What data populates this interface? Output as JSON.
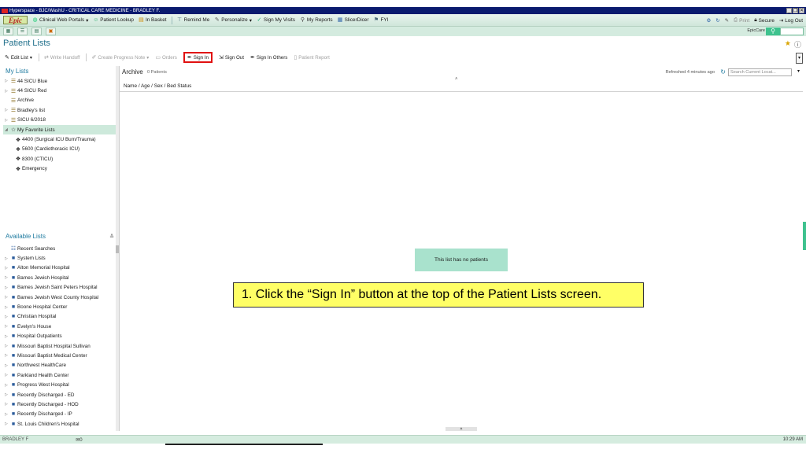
{
  "window": {
    "title": "Hyperspace - BJC/WashU - CRITICAL CARE MEDICINE - BRADLEY F."
  },
  "menu": {
    "logo": "Epic",
    "items": [
      {
        "label": "Clinical Web Portals",
        "icon": "globe-icon"
      },
      {
        "label": "Patient Lookup",
        "icon": "person-icon"
      },
      {
        "label": "In Basket",
        "icon": "inbox-icon"
      },
      {
        "label": "Remind Me",
        "icon": "pin-icon"
      },
      {
        "label": "Personalize",
        "icon": "wrench-icon"
      },
      {
        "label": "Sign My Visits",
        "icon": "check-icon"
      },
      {
        "label": "My Reports",
        "icon": "magnifier-icon"
      },
      {
        "label": "SlicerDicer",
        "icon": "chart-icon"
      },
      {
        "label": "FYI",
        "icon": "flag-icon"
      }
    ],
    "right": {
      "print": "Print",
      "secure": "Secure",
      "logout": "Log Out"
    }
  },
  "row2": {
    "epiccare": "EpicCare"
  },
  "page": {
    "title": "Patient Lists"
  },
  "toolbar": {
    "edit_list": "Edit List",
    "write_handoff": "Write Handoff",
    "create_progress_note": "Create Progress Note",
    "orders": "Orders",
    "sign_in": "Sign In",
    "sign_out": "Sign Out",
    "sign_in_others": "Sign In Others",
    "patient_report": "Patient Report"
  },
  "my_lists": {
    "heading": "My Lists",
    "items": [
      {
        "label": "44 SICU Blue"
      },
      {
        "label": "44 SICU Red"
      },
      {
        "label": "Archive"
      },
      {
        "label": "Bradley's list"
      },
      {
        "label": "SICU 6/2018"
      },
      {
        "label": "My Favorite Lists"
      },
      {
        "label": "4400 (Surgical ICU Burn/Trauma)"
      },
      {
        "label": "5600 (Cardiothoracic ICU)"
      },
      {
        "label": "8300 (CTICU)"
      },
      {
        "label": "Emergency"
      }
    ]
  },
  "available_lists": {
    "heading": "Available Lists",
    "items": [
      {
        "label": "Recent Searches"
      },
      {
        "label": "System Lists"
      },
      {
        "label": "Alton Memorial Hospital"
      },
      {
        "label": "Barnes Jewish Hospital"
      },
      {
        "label": "Barnes Jewish Saint Peters Hospital"
      },
      {
        "label": "Barnes Jewish West County Hospital"
      },
      {
        "label": "Boone Hospital Center"
      },
      {
        "label": "Christian Hospital"
      },
      {
        "label": "Evelyn's House"
      },
      {
        "label": "Hospital Outpatients"
      },
      {
        "label": "Missouri Baptist Hospital Sullivan"
      },
      {
        "label": "Missouri Baptist Medical Center"
      },
      {
        "label": "Northwest HealthCare"
      },
      {
        "label": "Parkland Health Center"
      },
      {
        "label": "Progress West Hospital"
      },
      {
        "label": "Recently Discharged - ED"
      },
      {
        "label": "Recently Discharged - HOD"
      },
      {
        "label": "Recently Discharged - IP"
      },
      {
        "label": "St. Louis Children's Hospital"
      }
    ]
  },
  "main": {
    "list_title": "Archive",
    "patient_count": "0 Patients",
    "refreshed": "Refreshed 4 minutes ago",
    "search_placeholder": "Search Current Locat...",
    "column_header": "Name / Age / Sex / Bed Status",
    "empty_message": "This list has no patients"
  },
  "callout": {
    "text": "1. Click the “Sign In” button at the top of the Patient Lists screen."
  },
  "status": {
    "user": "BRADLEY F",
    "messages": "0",
    "time": "10:29 AM"
  },
  "colors": {
    "accent": "#3ec28e",
    "highlight": "#e01010",
    "callout": "#ffff66",
    "title_bar": "#0a1a6e"
  }
}
